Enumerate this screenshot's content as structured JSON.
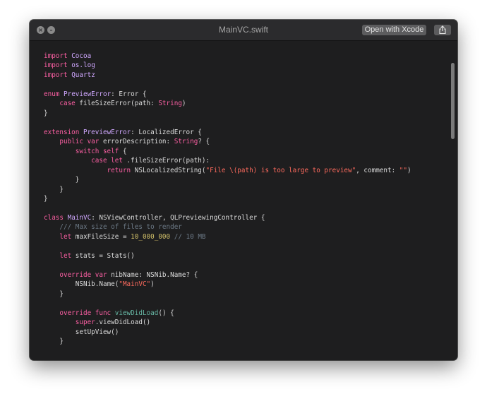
{
  "window": {
    "title": "MainVC.swift",
    "open_button_label": "Open with Xcode",
    "share_icon": "share-icon",
    "close_icon": "close-icon",
    "minimize_icon": "minimize-icon"
  },
  "colors": {
    "background": "#1e1e1f",
    "keyword": "#fc5fa3",
    "type": "#d0a8ff",
    "function": "#67b7a4",
    "string": "#fc6a5d",
    "number": "#d0bf69",
    "comment": "#6c7986",
    "plain": "#dcdcdc"
  },
  "code": {
    "language": "swift",
    "lines": [
      [
        [
          "kw",
          "import"
        ],
        [
          "tx",
          " "
        ],
        [
          "ty",
          "Cocoa"
        ]
      ],
      [
        [
          "kw",
          "import"
        ],
        [
          "tx",
          " "
        ],
        [
          "ty",
          "os.log"
        ]
      ],
      [
        [
          "kw",
          "import"
        ],
        [
          "tx",
          " "
        ],
        [
          "ty",
          "Quartz"
        ]
      ],
      [],
      [
        [
          "kw",
          "enum"
        ],
        [
          "tx",
          " "
        ],
        [
          "ty",
          "PreviewError"
        ],
        [
          "tx",
          ": Error {"
        ]
      ],
      [
        [
          "tx",
          "    "
        ],
        [
          "kw",
          "case"
        ],
        [
          "tx",
          " fileSizeError(path: "
        ],
        [
          "kw",
          "String"
        ],
        [
          "tx",
          ")"
        ]
      ],
      [
        [
          "tx",
          "}"
        ]
      ],
      [],
      [
        [
          "kw",
          "extension"
        ],
        [
          "tx",
          " "
        ],
        [
          "ty",
          "PreviewError"
        ],
        [
          "tx",
          ": LocalizedError {"
        ]
      ],
      [
        [
          "tx",
          "    "
        ],
        [
          "kw",
          "public var"
        ],
        [
          "tx",
          " errorDescription: "
        ],
        [
          "kw",
          "String"
        ],
        [
          "tx",
          "? {"
        ]
      ],
      [
        [
          "tx",
          "        "
        ],
        [
          "kw",
          "switch self"
        ],
        [
          "tx",
          " {"
        ]
      ],
      [
        [
          "tx",
          "            "
        ],
        [
          "kw",
          "case let"
        ],
        [
          "tx",
          " .fileSizeError(path):"
        ]
      ],
      [
        [
          "tx",
          "                "
        ],
        [
          "kw",
          "return"
        ],
        [
          "tx",
          " NSLocalizedString("
        ],
        [
          "str",
          "\"File \\(path) is too large to preview\""
        ],
        [
          "tx",
          ", comment: "
        ],
        [
          "str",
          "\"\""
        ],
        [
          "tx",
          ")"
        ]
      ],
      [
        [
          "tx",
          "        }"
        ]
      ],
      [
        [
          "tx",
          "    }"
        ]
      ],
      [
        [
          "tx",
          "}"
        ]
      ],
      [],
      [
        [
          "kw",
          "class"
        ],
        [
          "tx",
          " "
        ],
        [
          "ty",
          "MainVC"
        ],
        [
          "tx",
          ": NSViewController, QLPreviewingController {"
        ]
      ],
      [
        [
          "tx",
          "    "
        ],
        [
          "cm",
          "/// Max size of files to render"
        ]
      ],
      [
        [
          "tx",
          "    "
        ],
        [
          "kw",
          "let"
        ],
        [
          "tx",
          " maxFileSize = "
        ],
        [
          "num",
          "10_000_000"
        ],
        [
          "tx",
          " "
        ],
        [
          "cm",
          "// 10 MB"
        ]
      ],
      [],
      [
        [
          "tx",
          "    "
        ],
        [
          "kw",
          "let"
        ],
        [
          "tx",
          " stats = Stats()"
        ]
      ],
      [],
      [
        [
          "tx",
          "    "
        ],
        [
          "kw",
          "override var"
        ],
        [
          "tx",
          " nibName: NSNib.Name? {"
        ]
      ],
      [
        [
          "tx",
          "        NSNib.Name("
        ],
        [
          "str",
          "\"MainVC\""
        ],
        [
          "tx",
          ")"
        ]
      ],
      [
        [
          "tx",
          "    }"
        ]
      ],
      [],
      [
        [
          "tx",
          "    "
        ],
        [
          "kw",
          "override func"
        ],
        [
          "tx",
          " "
        ],
        [
          "fn",
          "viewDidLoad"
        ],
        [
          "tx",
          "() {"
        ]
      ],
      [
        [
          "tx",
          "        "
        ],
        [
          "kw",
          "super"
        ],
        [
          "tx",
          ".viewDidLoad()"
        ]
      ],
      [
        [
          "tx",
          "        setUpView()"
        ]
      ],
      [
        [
          "tx",
          "    }"
        ]
      ]
    ]
  }
}
